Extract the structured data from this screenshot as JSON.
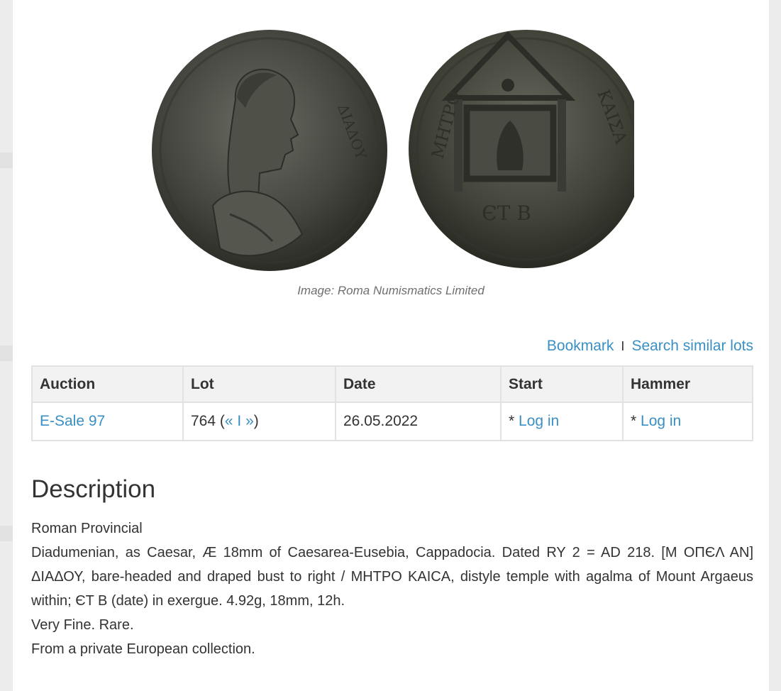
{
  "image": {
    "caption": "Image: Roma Numismatics Limited",
    "obverse_legend": "ΔΙΑΔΟΥ",
    "reverse_legend_left": "ΜΗΤΡΟ",
    "reverse_legend_right": "ΚΑΙΣΑ",
    "reverse_exergue": "ЄΤ Β"
  },
  "actions": {
    "bookmark": "Bookmark",
    "separator": "I",
    "search_similar": "Search similar lots"
  },
  "table": {
    "headers": [
      "Auction",
      "Lot",
      "Date",
      "Start",
      "Hammer"
    ],
    "row": {
      "auction": "E-Sale 97",
      "lot_number": "764 (",
      "lot_prev": "«",
      "lot_sep": " I ",
      "lot_next": "»",
      "lot_close": ")",
      "date": "26.05.2022",
      "start_prefix": "* ",
      "start_link": "Log in",
      "hammer_prefix": "* ",
      "hammer_link": "Log in"
    }
  },
  "description": {
    "title": "Description",
    "category": "Roman Provincial",
    "text": "Diadumenian, as Caesar, Æ 18mm of Caesarea-Eusebia, Cappadocia. Dated RY 2 = AD 218. [Μ ΟΠЄΛ ΑΝ] ΔΙΑΔΟΥ, bare-headed and draped bust to right / ΜΗΤΡΟ ΚΑΙϹΑ, distyle temple with agalma of Mount Argaeus within; ЄΤ Β (date) in exergue. 4.92g, 18mm, 12h.",
    "grade": "Very Fine. Rare.",
    "provenance": "From a private European collection."
  }
}
